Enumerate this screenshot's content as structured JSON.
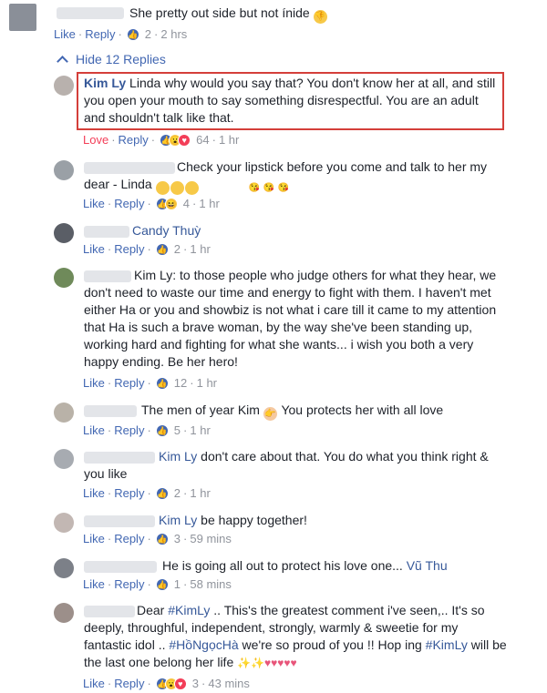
{
  "top": {
    "text": "She pretty out side but not ínide",
    "emoji": "thumbs-down",
    "like": "Like",
    "reply": "Reply",
    "count": "2",
    "time": "2 hrs"
  },
  "hide_replies": "Hide 12 Replies",
  "replies": [
    {
      "name": "Kim Ly",
      "text": " Linda why would you say that? You don't know her at all, and still you open your mouth to say something disrespectful. You are an adult and shouldn't talk like that.",
      "like": "Love",
      "reply": "Reply",
      "count": "64",
      "time": "1 hr"
    },
    {
      "text": "Check your lipstick before you come and talk to her my dear - Linda",
      "like": "Like",
      "reply": "Reply",
      "count": "4",
      "time": "1 hr"
    },
    {
      "name": "Candy Thuỳ",
      "like": "Like",
      "reply": "Reply",
      "count": "2",
      "time": "1 hr"
    },
    {
      "text": "Kim Ly: to those people who judge others for what they hear, we don't need to waste our time and energy to fight with them. I haven't met either Ha or you and showbiz is not what i care till it came to my attention that Ha is such a brave woman, by the way she've been standing up, working hard and fighting for what she wants... i wish you both a very happy ending. Be her hero!",
      "like": "Like",
      "reply": "Reply",
      "count": "12",
      "time": "1 hr"
    },
    {
      "text_a": "The men of year Kim",
      "text_b": " You protects her with all love",
      "like": "Like",
      "reply": "Reply",
      "count": "5",
      "time": "1 hr"
    },
    {
      "name": "Kim Ly",
      "text": " don't care about that. You do what you think right & you like",
      "like": "Like",
      "reply": "Reply",
      "count": "2",
      "time": "1 hr"
    },
    {
      "name": "Kim Ly",
      "text": " be happy together!",
      "like": "Like",
      "reply": "Reply",
      "count": "3",
      "time": "59 mins"
    },
    {
      "text": "He is going all out to protect his love one... ",
      "tag": "Vũ Thu",
      "like": "Like",
      "reply": "Reply",
      "count": "1",
      "time": "58 mins"
    },
    {
      "text_a": "Dear ",
      "tag_a": "#KimLy",
      "text_b": " .. This's the greatest comment i've seen,.. It's so deeply, throughful, independent, strongly, warmly & sweetie for my fantastic idol .. ",
      "tag_b": "#HồNgọcHà",
      "text_c": " we're so proud of you !! Hop ing ",
      "tag_c": "#KimLy",
      "text_d": " will be the last one belong her life",
      "like": "Like",
      "reply": "Reply",
      "count": "3",
      "time": "43 mins"
    }
  ],
  "sep": "·"
}
